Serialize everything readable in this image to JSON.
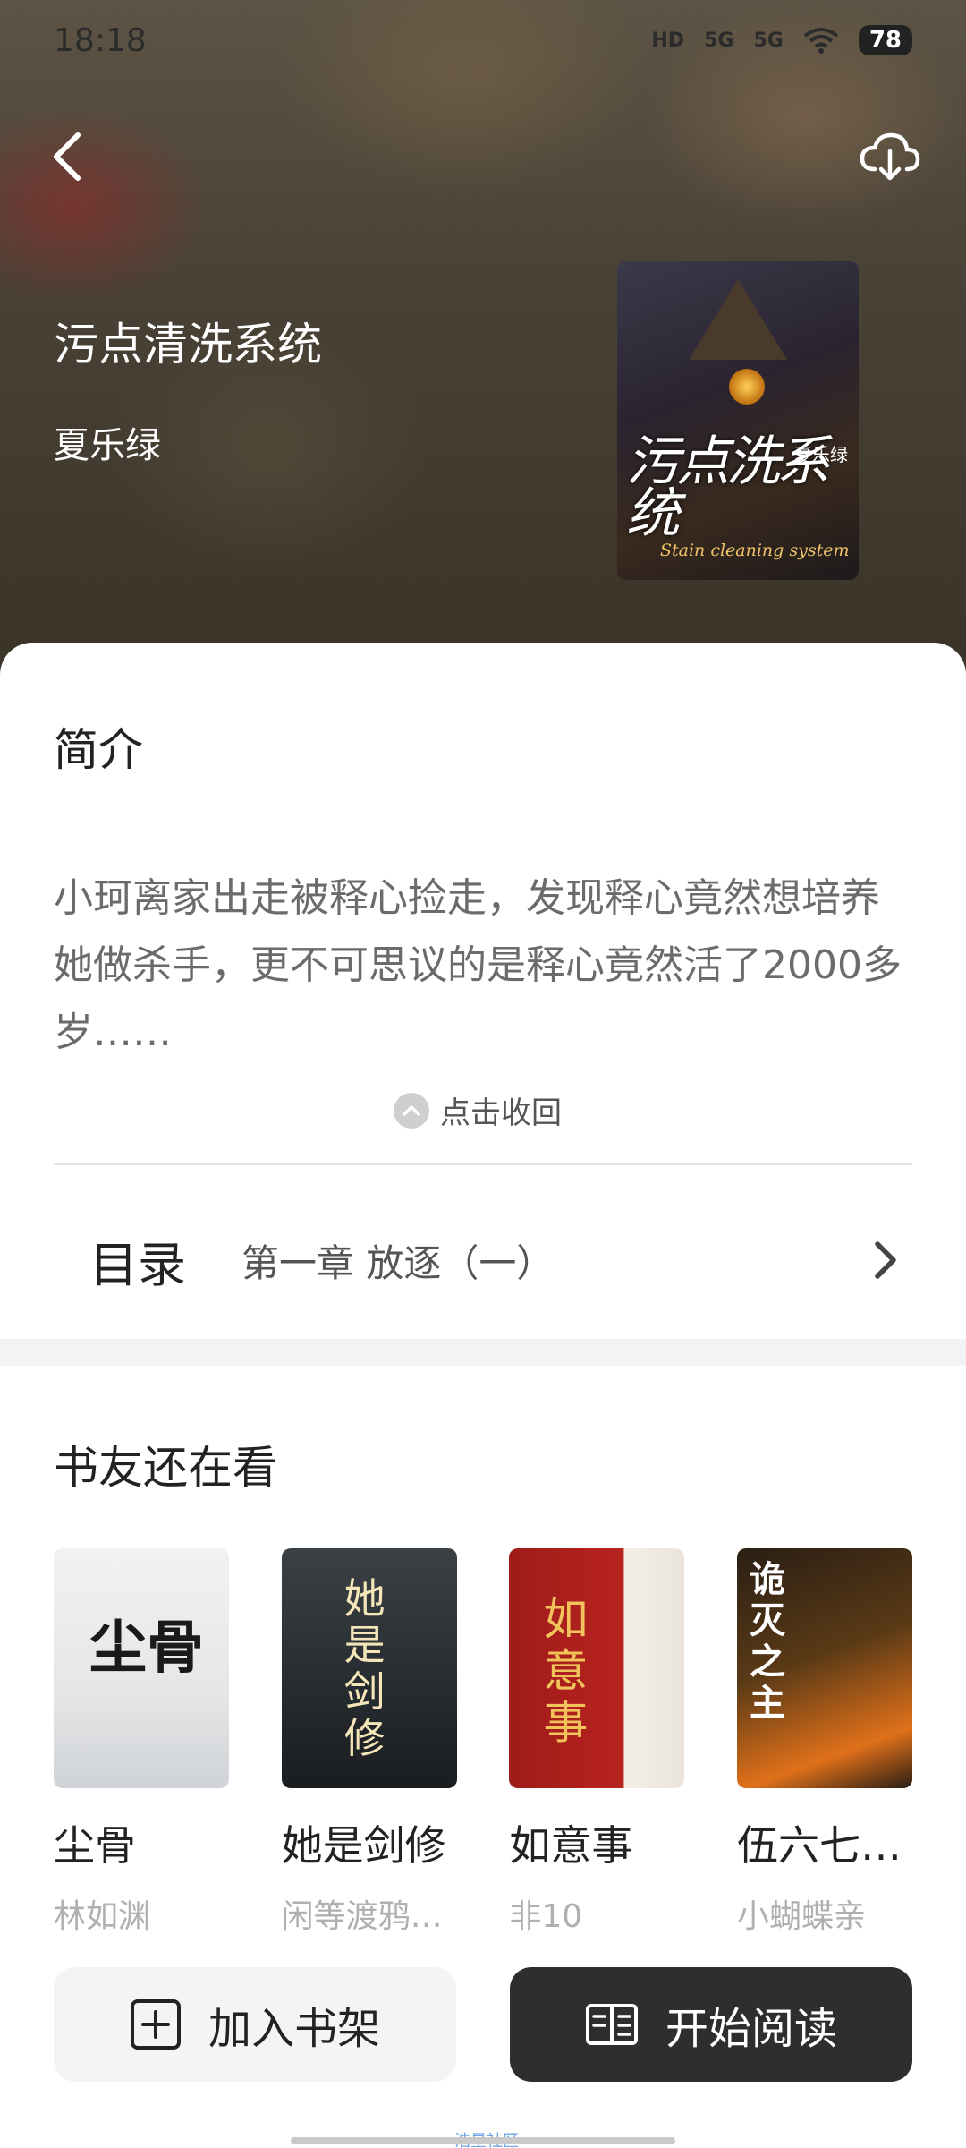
{
  "status_bar": {
    "time": "18:18",
    "hd": "HD",
    "signal_1": "5G",
    "signal_2": "5G",
    "battery": "78"
  },
  "book": {
    "title": "污点清洗系统",
    "author": "夏乐绿",
    "cover_title": "污点洗系统",
    "cover_author": "夏乐绿",
    "cover_subtitle": "Stain cleaning system"
  },
  "intro": {
    "heading": "简介",
    "text": "小珂离家出走被释心捡走，发现释心竟然想培养她做杀手，更不可思议的是释心竟然活了2000多岁……",
    "collapse_label": "点击收回"
  },
  "toc": {
    "label": "目录",
    "chapter": "第一章 放逐（一）"
  },
  "recommendations": {
    "heading": "书友还在看",
    "items": [
      {
        "title": "尘骨",
        "author": "林如渊",
        "cover_text": "尘骨"
      },
      {
        "title": "她是剑修",
        "author": "闲等渡鸦…",
        "cover_text": "她是剑修"
      },
      {
        "title": "如意事",
        "author": "非10",
        "cover_text": "如意事"
      },
      {
        "title": "伍六七…",
        "author": "小蝴蝶亲",
        "cover_text": "诡灭之主"
      }
    ]
  },
  "actions": {
    "add_shelf": "加入书架",
    "start_reading": "开始阅读"
  },
  "watermark": "浩星社区",
  "colors": {
    "read_button_bg": "#2e2e2e",
    "shelf_button_bg": "#f4f4f4"
  }
}
